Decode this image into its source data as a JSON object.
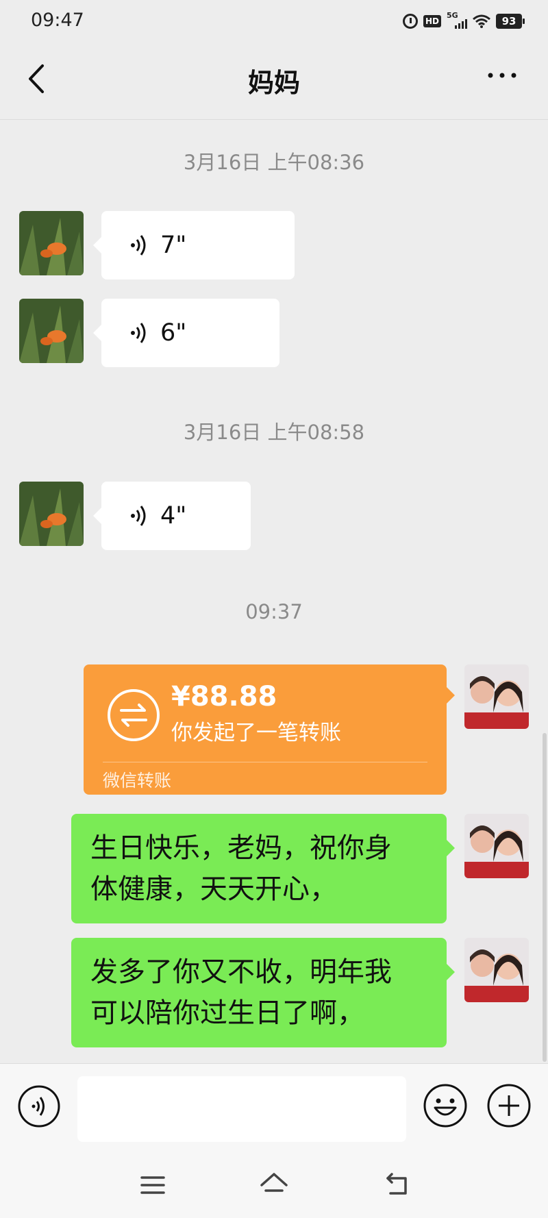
{
  "status_bar": {
    "time": "09:47",
    "hd": "HD",
    "network": "5G",
    "battery": "93"
  },
  "header": {
    "title": "妈妈"
  },
  "timestamps": [
    "3月16日 上午08:36",
    "3月16日 上午08:58",
    "09:37"
  ],
  "voice_messages": [
    {
      "duration": "7\""
    },
    {
      "duration": "6\""
    },
    {
      "duration": "4\""
    }
  ],
  "transfer": {
    "amount": "¥88.88",
    "description": "你发起了一笔转账",
    "footer": "微信转账"
  },
  "text_messages": [
    {
      "line1": "生日快乐，老妈，祝你身",
      "line2": "体健康，天天开心，"
    },
    {
      "line1": "发多了你又不收，明年我",
      "line2": "可以陪你过生日了啊，"
    }
  ],
  "colors": {
    "transfer": "#fa9d3b",
    "sent_bubble": "#7aeb55",
    "background": "#ededed"
  },
  "icons": [
    "back-arrow-icon",
    "more-icon",
    "voice-icon",
    "transfer-icon",
    "emoji-icon",
    "plus-icon",
    "menu-icon",
    "home-icon",
    "back-nav-icon"
  ]
}
